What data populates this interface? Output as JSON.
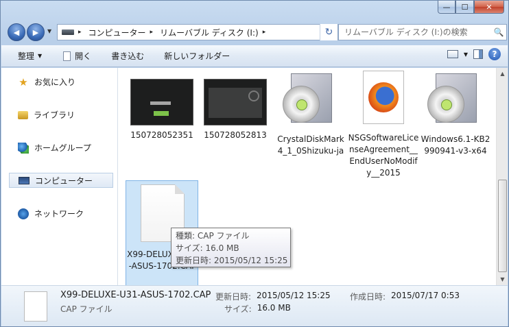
{
  "window": {
    "caption": {
      "minimize": "—",
      "maximize": "☐",
      "close": "✕"
    }
  },
  "nav": {
    "back_glyph": "◀",
    "forward_glyph": "▶",
    "history_glyph": "▼",
    "breadcrumbs": [
      {
        "label": "コンピューター"
      },
      {
        "label": "リムーバブル ディスク (I:)"
      }
    ],
    "crumb_arrow": "▸",
    "refresh_glyph": "↻",
    "search_placeholder": "リムーバブル ディスク (I:)の検索",
    "search_glyph": "🔍"
  },
  "toolbar": {
    "organize": "整理",
    "open": "開く",
    "burn": "書き込む",
    "new_folder": "新しいフォルダー",
    "dropdown_glyph": "▼",
    "help_glyph": "?"
  },
  "sidebar": {
    "items": [
      {
        "label": "お気に入り",
        "icon": "star-icon"
      },
      {
        "label": "ライブラリ",
        "icon": "library-icon"
      },
      {
        "label": "ホームグループ",
        "icon": "homegroup-icon"
      },
      {
        "label": "コンピューター",
        "icon": "computer-icon"
      },
      {
        "label": "ネットワーク",
        "icon": "network-icon"
      }
    ]
  },
  "files": [
    {
      "name": "150728052351",
      "kind": "image"
    },
    {
      "name": "150728052813",
      "kind": "image"
    },
    {
      "name": "CrystalDiskMark4_1_0Shizuku-ja",
      "kind": "installer"
    },
    {
      "name": "NSGSoftwareLicenseAgreement__EndUserNoModify__2015",
      "kind": "firefox-document"
    },
    {
      "name": "Windows6.1-KB2990941-v3-x64",
      "kind": "installer"
    },
    {
      "name": "X99-DELUXE-U31-ASUS-1702.CAP",
      "kind": "generic-file",
      "selected": true
    }
  ],
  "tooltip": {
    "type_label": "種類:",
    "type_value": "CAP ファイル",
    "size_label": "サイズ:",
    "size_value": "16.0 MB",
    "modified_label": "更新日時:",
    "modified_value": "2015/05/12 15:25"
  },
  "details": {
    "name": "X99-DELUXE-U31-ASUS-1702.CAP",
    "type": "CAP ファイル",
    "modified_label": "更新日時:",
    "modified_value": "2015/05/12 15:25",
    "created_label": "作成日時:",
    "created_value": "2015/07/17 0:53",
    "size_label": "サイズ:",
    "size_value": "16.0 MB"
  },
  "scrollbar": {
    "up_glyph": "▲",
    "down_glyph": "▼"
  }
}
